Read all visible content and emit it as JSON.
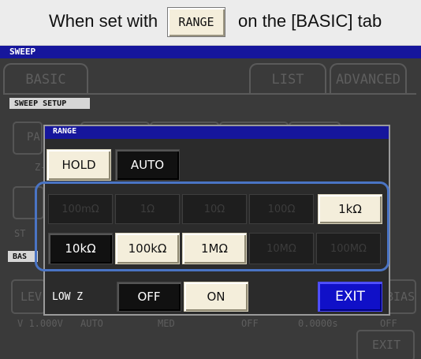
{
  "caption": {
    "prefix": "When set with",
    "button_label": "RANGE",
    "suffix": "on the [BASIC] tab"
  },
  "screen": {
    "title": "SWEEP",
    "tabs": {
      "basic": "BASIC",
      "list": "LIST",
      "advanced": "ADVANCED"
    },
    "sweep_setup_label": "SWEEP SETUP",
    "bas_label": "BAS",
    "partial": {
      "pa": "PA",
      "z": "Z-",
      "st": "ST",
      "lev": "LEV",
      "bias": "BIAS",
      "exit": "EXIT"
    },
    "status_row": [
      "V 1.000V",
      "AUTO",
      "MED",
      "OFF",
      "0.0000s",
      "OFF"
    ]
  },
  "dialog": {
    "title": "RANGE",
    "mode_buttons": {
      "hold": "HOLD",
      "auto": "AUTO"
    },
    "range_row1": [
      "100mΩ",
      "1Ω",
      "10Ω",
      "100Ω",
      "1kΩ"
    ],
    "range_row2": [
      "10kΩ",
      "100kΩ",
      "1MΩ",
      "10MΩ",
      "100MΩ"
    ],
    "low_z_label": "LOW Z",
    "low_z_off": "OFF",
    "low_z_on": "ON",
    "exit_label": "EXIT"
  },
  "colors": {
    "titlebar_blue": "#16169c",
    "button_cream": "#f4eedb",
    "exit_blue": "#1010c8",
    "highlight_blue": "#4a74c4"
  }
}
